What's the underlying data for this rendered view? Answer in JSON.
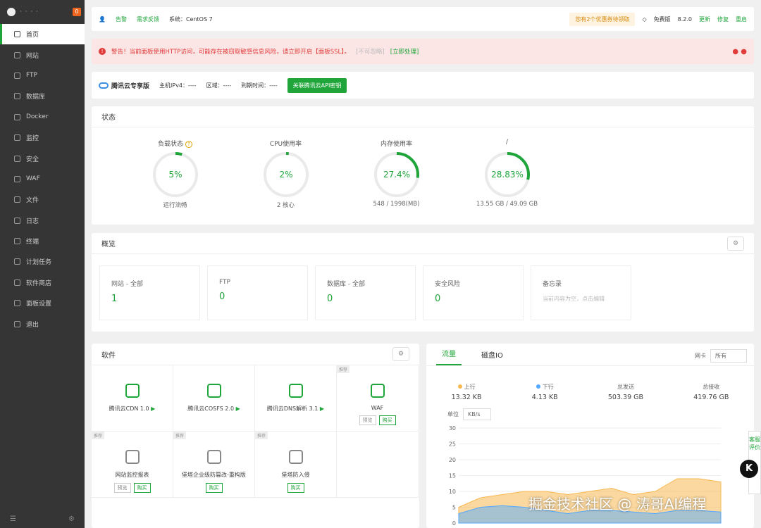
{
  "sidebar": {
    "logo_text": "· · · ·",
    "badge": "0",
    "items": [
      {
        "label": "首页",
        "active": true
      },
      {
        "label": "网站"
      },
      {
        "label": "FTP"
      },
      {
        "label": "数据库"
      },
      {
        "label": "Docker"
      },
      {
        "label": "监控"
      },
      {
        "label": "安全"
      },
      {
        "label": "WAF"
      },
      {
        "label": "文件"
      },
      {
        "label": "日志"
      },
      {
        "label": "终端"
      },
      {
        "label": "计划任务"
      },
      {
        "label": "软件商店"
      },
      {
        "label": "面板设置"
      },
      {
        "label": "退出"
      }
    ]
  },
  "topbar": {
    "message_label": "告警",
    "feedback_label": "需求反馈",
    "system_label": "系统：CentOS 7",
    "coupon_label": "您有2个优惠券待领取",
    "edition_label": "免费版",
    "version": "8.2.0",
    "update_label": "更新",
    "repair_label": "修复",
    "restart_label": "重启"
  },
  "alert": {
    "text": "警告！当前面板使用HTTP访问，可能存在被窃取敏感信息风险，请立即开启【面板SSL】。",
    "ignore_label": "[不可忽略]",
    "fix_label": "[立即处理]"
  },
  "cloud": {
    "brand": "腾讯云专享版",
    "ipv4": "主机IPv4：----",
    "region": "区域：----",
    "expire": "到期时间：----",
    "button": "关联腾讯云API密钥"
  },
  "status": {
    "title": "状态",
    "gauges": [
      {
        "label": "负载状态",
        "value_text": "5%",
        "percent": 5,
        "sub": "运行流畅",
        "help": "?"
      },
      {
        "label": "CPU使用率",
        "value_text": "2%",
        "percent": 2,
        "sub": "2 核心"
      },
      {
        "label": "内存使用率",
        "value_text": "27.4%",
        "percent": 27.4,
        "sub": "548 / 1998(MB)"
      },
      {
        "label": "/",
        "value_text": "28.83%",
        "percent": 28.83,
        "sub": "13.55 GB / 49.09 GB"
      }
    ]
  },
  "overview": {
    "title": "概览",
    "cards": [
      {
        "name": "网站 - 全部",
        "value": "1"
      },
      {
        "name": "FTP",
        "value": "0"
      },
      {
        "name": "数据库 - 全部",
        "value": "0"
      },
      {
        "name": "安全风险",
        "value": "0"
      },
      {
        "name": "备忘录",
        "memo": "当前内容为空，点击编辑"
      }
    ]
  },
  "software": {
    "title": "软件",
    "rec_label": "推荐",
    "preview_label": "预览",
    "buy_label": "购买",
    "items": [
      {
        "name": "腾讯云CDN 1.0",
        "play": true
      },
      {
        "name": "腾讯云COSFS 2.0",
        "play": true
      },
      {
        "name": "腾讯云DNS解析 3.1",
        "play": true
      },
      {
        "name": "WAF",
        "rec": true,
        "preview": true,
        "buy": true
      },
      {
        "name": "网站监控报表",
        "rec": true,
        "preview": true,
        "buy": true
      },
      {
        "name": "堡塔企业级防篡改-重构版",
        "rec": true,
        "buy": true
      },
      {
        "name": "堡塔防入侵",
        "rec": true,
        "buy": true
      },
      {
        "name": ""
      }
    ]
  },
  "traffic": {
    "tabs": [
      "流量",
      "磁盘IO"
    ],
    "nic_label": "网卡",
    "nic_value": "所有",
    "up_label": "上行",
    "up_value": "13.32 KB",
    "down_label": "下行",
    "down_value": "4.13 KB",
    "sent_label": "总发送",
    "sent_value": "503.39 GB",
    "recv_label": "总接收",
    "recv_value": "419.76 GB",
    "unit_label": "单位",
    "unit_value": "KB/s"
  },
  "chart_data": {
    "type": "area",
    "ylim": [
      0,
      30
    ],
    "yticks": [
      0,
      5,
      10,
      15,
      20,
      25,
      30
    ],
    "series": [
      {
        "name": "上行",
        "color": "#f7b851",
        "values": [
          5,
          8,
          9,
          10,
          10,
          9,
          10,
          11,
          9,
          10,
          14,
          14,
          13
        ]
      },
      {
        "name": "下行",
        "color": "#52a9ff",
        "values": [
          3,
          5,
          5.5,
          5,
          4,
          3,
          4,
          4,
          3.5,
          3,
          4,
          4,
          3.5
        ]
      }
    ]
  },
  "floating": {
    "k_label": "K",
    "side_text": "客服 评价"
  },
  "watermark": "掘金技术社区 @ 涛哥AI编程",
  "colors": {
    "accent": "#20a53a",
    "sidebar": "#353535",
    "alert": "#e13c3c"
  }
}
